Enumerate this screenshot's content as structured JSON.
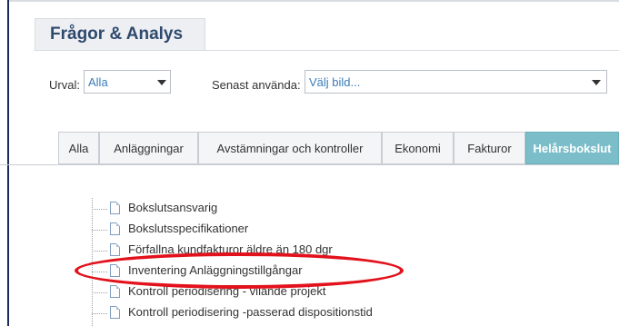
{
  "page": {
    "title": "Frågor & Analys"
  },
  "filters": {
    "urval_label": "Urval:",
    "urval_value": "Alla",
    "senast_label": "Senast använda:",
    "senast_value": "Välj bild..."
  },
  "tabs": [
    {
      "label": "Alla",
      "active": false
    },
    {
      "label": "Anläggningar",
      "active": false
    },
    {
      "label": "Avstämningar och kontroller",
      "active": false
    },
    {
      "label": "Ekonomi",
      "active": false
    },
    {
      "label": "Fakturor",
      "active": false
    },
    {
      "label": "Helårsbokslut",
      "active": true
    }
  ],
  "reports": [
    {
      "label": "Bokslutsansvarig"
    },
    {
      "label": "Bokslutsspecifikationer"
    },
    {
      "label": "Förfallna kundfakturor äldre än 180 dgr"
    },
    {
      "label": "Inventering Anläggningstillgångar",
      "highlighted": true
    },
    {
      "label": "Kontroll periodisering - vilande projekt"
    },
    {
      "label": "Kontroll periodisering -passerad dispositionstid"
    }
  ],
  "colors": {
    "accent_tab": "#7bbec9",
    "highlight": "#e2111b",
    "title_text": "#2f4a6e",
    "select_text": "#3a7cb8"
  }
}
